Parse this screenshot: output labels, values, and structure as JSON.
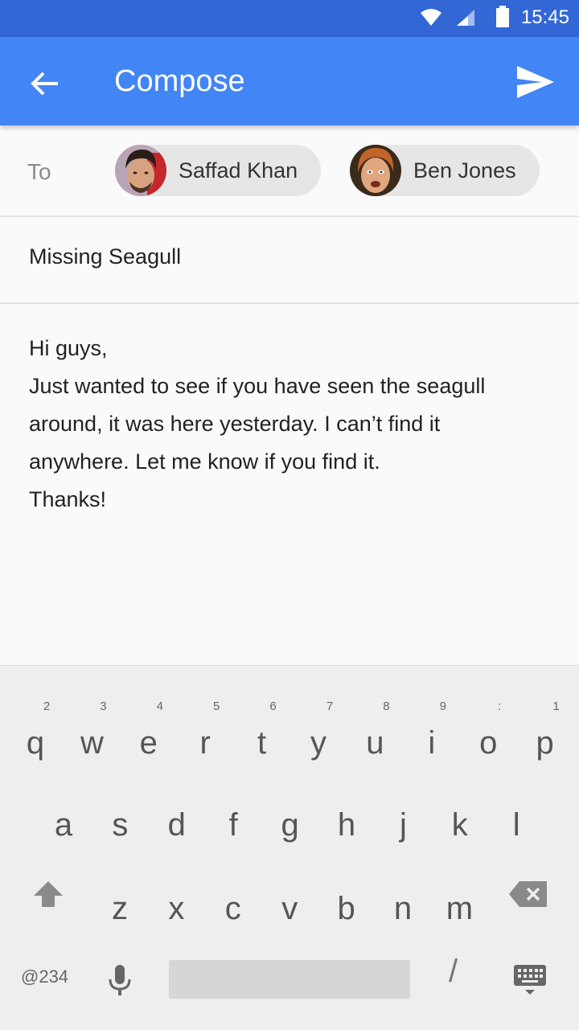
{
  "status_bar": {
    "time": "15:45"
  },
  "app_bar": {
    "title": "Compose"
  },
  "recipients": {
    "label": "To",
    "chips": [
      {
        "name": "Saffad Khan"
      },
      {
        "name": "Ben Jones"
      }
    ]
  },
  "subject": "Missing Seagull",
  "body": {
    "lines": [
      "Hi guys,",
      "Just wanted to see if you have seen the seagull",
      "around, it was here yesterday. I can’t find it",
      "anywhere. Let me know if you find it.",
      "Thanks!"
    ]
  },
  "keyboard": {
    "row1": [
      {
        "key": "q",
        "hint": "2"
      },
      {
        "key": "w",
        "hint": "3"
      },
      {
        "key": "e",
        "hint": "4"
      },
      {
        "key": "r",
        "hint": "5"
      },
      {
        "key": "t",
        "hint": "6"
      },
      {
        "key": "y",
        "hint": "7"
      },
      {
        "key": "u",
        "hint": "8"
      },
      {
        "key": "i",
        "hint": "9"
      },
      {
        "key": "o",
        "hint": ":"
      },
      {
        "key": "p",
        "hint": "1"
      }
    ],
    "row2": [
      "a",
      "s",
      "d",
      "f",
      "g",
      "h",
      "j",
      "k",
      "l"
    ],
    "row3": [
      "z",
      "x",
      "c",
      "v",
      "b",
      "n",
      "m"
    ],
    "symbols_label": "@234",
    "slash_label": "/"
  },
  "colors": {
    "status_bar": "#3367d6",
    "app_bar": "#4285f4",
    "chip": "#e6e6e6",
    "keyboard": "#eeeeee"
  }
}
